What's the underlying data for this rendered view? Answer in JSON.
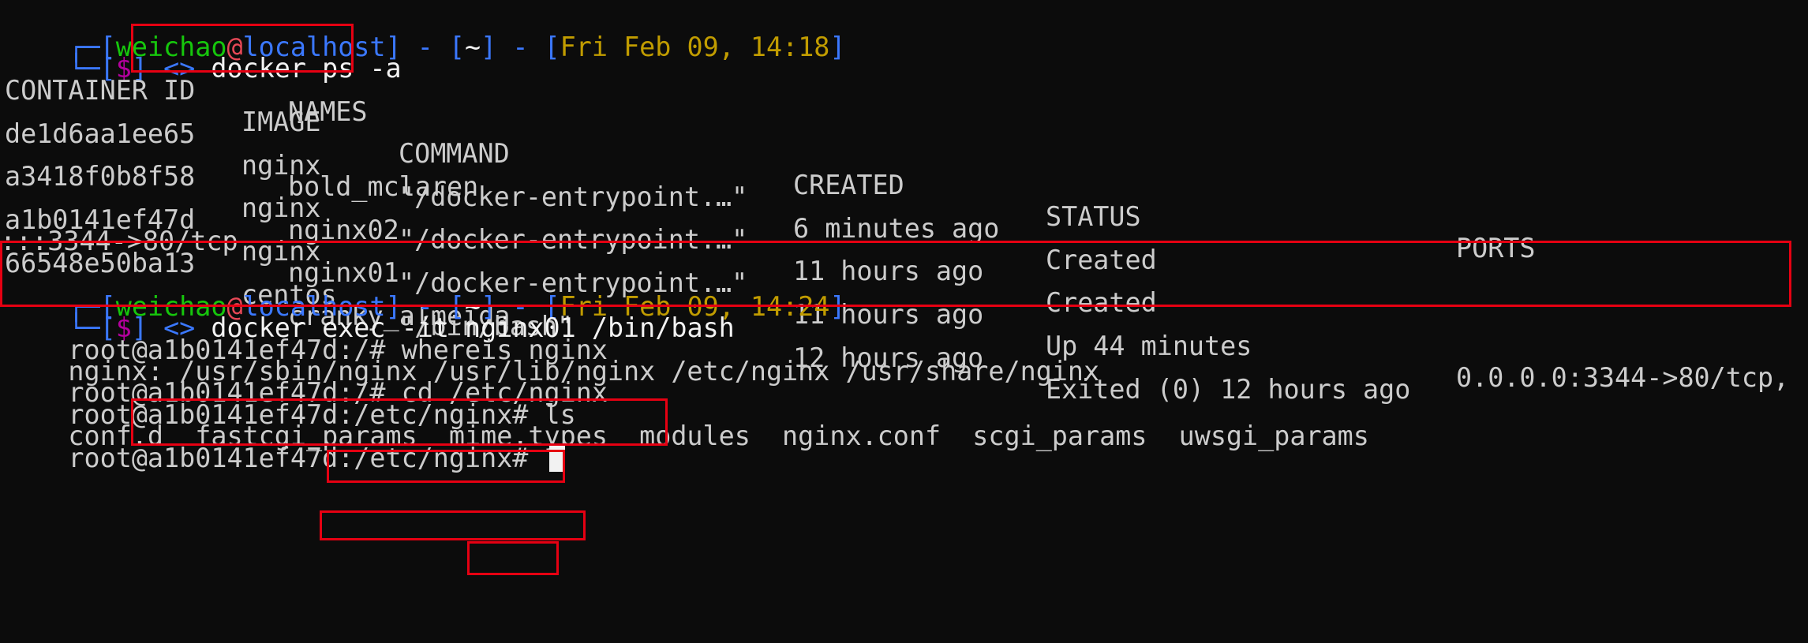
{
  "prompts": [
    {
      "open": "┌─[",
      "user": "weichao",
      "at": "@",
      "host": "localhost",
      "mid1": "] - [",
      "dir": "~",
      "mid2": "] - [",
      "time": "Fri Feb 09, 14:18",
      "close": "]",
      "line2_prefix": "└─[",
      "dollar": "$",
      "line2_mid": "] ",
      "arrow": "<>",
      "command": " docker ps -a"
    },
    {
      "open": "┌─[",
      "user": "weichao",
      "at": "@",
      "host": "localhost",
      "mid1": "] - [",
      "dir": "~",
      "mid2": "] - [",
      "time": "Fri Feb 09, 14:24",
      "close": "]",
      "line2_prefix": "└─[",
      "dollar": "$",
      "line2_mid": "] ",
      "arrow": "<>",
      "command": " docker exec -it nginx01 /bin/bash"
    }
  ],
  "ps_table": {
    "headers": {
      "container_id": "CONTAINER ID",
      "image": "IMAGE",
      "command": "COMMAND",
      "created": "CREATED",
      "status": "STATUS",
      "ports": "PORTS",
      "names": "NAMES"
    },
    "rows": [
      {
        "container_id": "de1d6aa1ee65",
        "image": "nginx",
        "command": "\"/docker-entrypoint.…\"",
        "created": "6 minutes ago",
        "status": "Created",
        "ports": "",
        "ports_wrap": "",
        "names": "bold_mclaren"
      },
      {
        "container_id": "a3418f0b8f58",
        "image": "nginx",
        "command": "\"/docker-entrypoint.…\"",
        "created": "11 hours ago",
        "status": "Created",
        "ports": "",
        "ports_wrap": "",
        "names": "nginx02"
      },
      {
        "container_id": "a1b0141ef47d",
        "image": "nginx",
        "command": "\"/docker-entrypoint.…\"",
        "created": "11 hours ago",
        "status": "Up 44 minutes",
        "ports": "0.0.0.0:3344->80/tcp,",
        "ports_wrap": ":::3344->80/tcp",
        "names": "nginx01"
      },
      {
        "container_id": "66548e50ba13",
        "image": "centos",
        "command": "\"/bin/bash\"",
        "created": "12 hours ago",
        "status": "Exited (0) 12 hours ago",
        "ports": "",
        "ports_wrap": "",
        "names": "cranky_almeida"
      }
    ]
  },
  "shell": [
    {
      "prompt": "root@a1b0141ef47d:/# ",
      "command": "whereis nginx"
    },
    {
      "output": "nginx: /usr/sbin/nginx /usr/lib/nginx /etc/nginx /usr/share/nginx"
    },
    {
      "prompt": "root@a1b0141ef47d:/# ",
      "command": "cd /etc/nginx"
    },
    {
      "prompt": "root@a1b0141ef47d:/etc/nginx# ",
      "command": "ls"
    },
    {
      "output": "conf.d  fastcgi_params  mime.types  modules  nginx.conf  scgi_params  uwsgi_params"
    },
    {
      "prompt": "root@a1b0141ef47d:/etc/nginx# ",
      "command": ""
    }
  ],
  "colors": {
    "background": "#0c0c0c",
    "bracket": "#3b78ff",
    "user": "#16c60c",
    "host": "#3b78ff",
    "at": "#e74856",
    "time": "#c19c00",
    "dollar": "#b4009e",
    "annotation": "#e60012"
  }
}
